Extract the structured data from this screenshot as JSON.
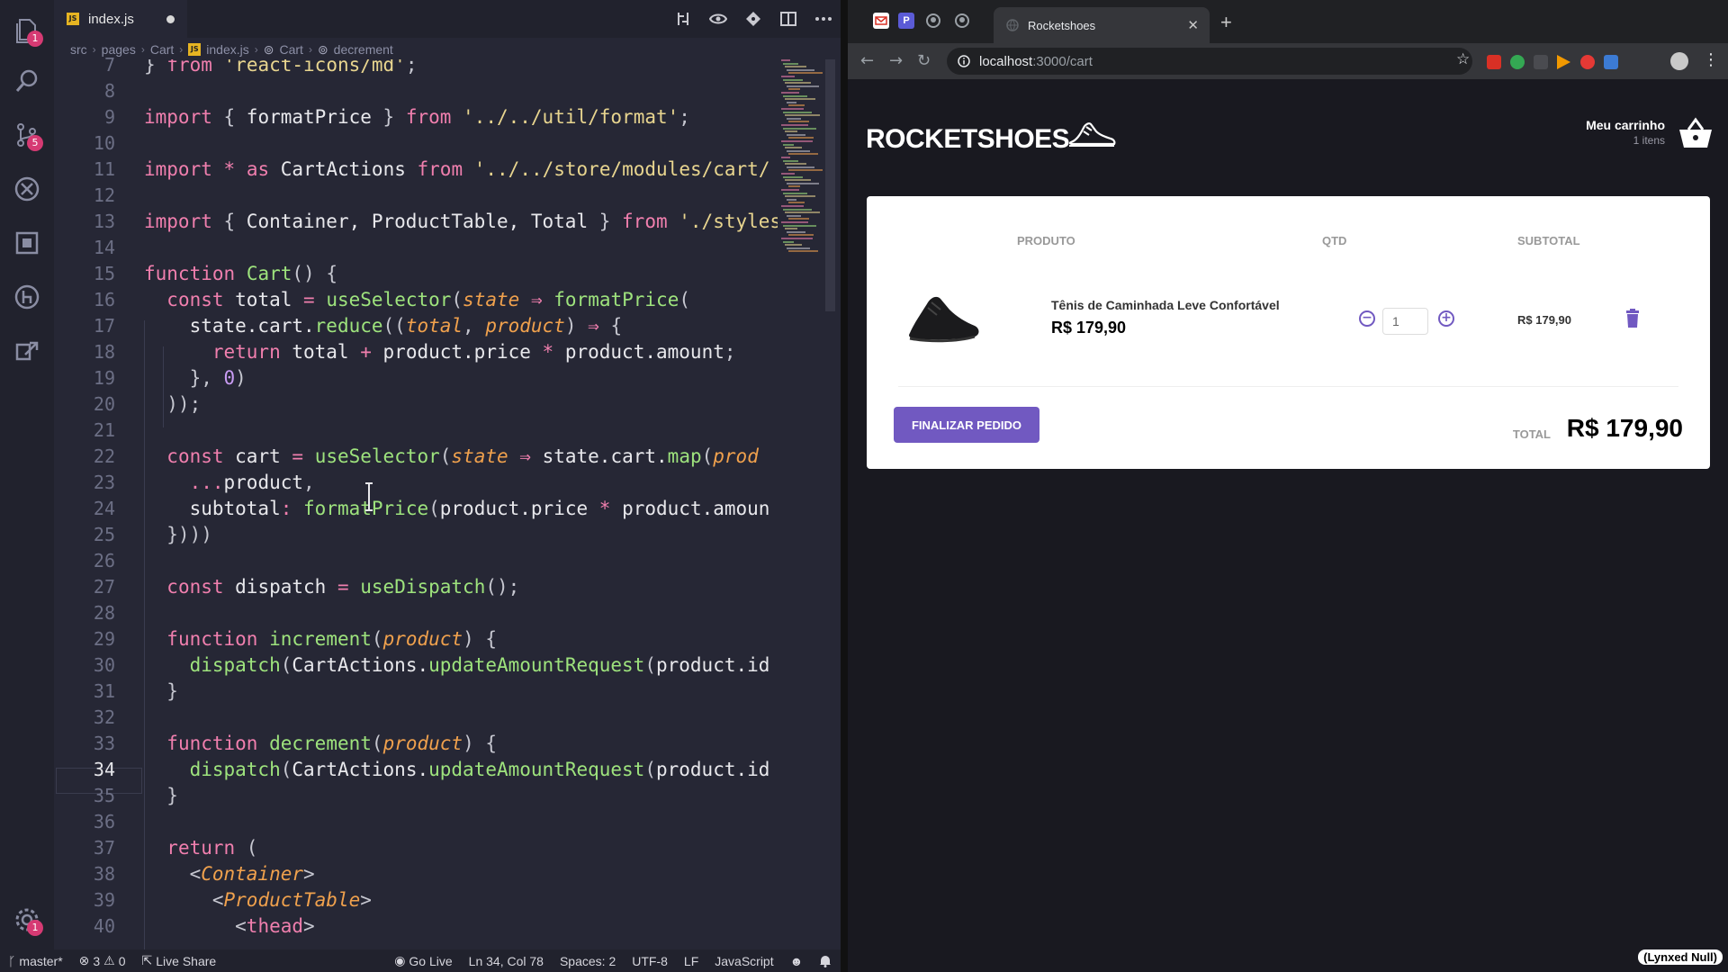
{
  "editor": {
    "tab": {
      "badge": "JS",
      "label": "index.js"
    },
    "breadcrumb": [
      "src",
      "pages",
      "Cart",
      "index.js",
      "Cart",
      "decrement"
    ],
    "activity_badges": {
      "explorer": "1",
      "scm": "5",
      "settings": "1"
    },
    "line_numbers": [
      "7",
      "8",
      "9",
      "10",
      "11",
      "12",
      "13",
      "14",
      "15",
      "16",
      "17",
      "18",
      "19",
      "20",
      "21",
      "22",
      "23",
      "24",
      "25",
      "26",
      "27",
      "28",
      "29",
      "30",
      "31",
      "32",
      "33",
      "34",
      "35",
      "36",
      "37",
      "38",
      "39",
      "40"
    ],
    "current_line": "34",
    "status": {
      "branch": "master*",
      "errors": "3",
      "warnings": "0",
      "live_share": "Live Share",
      "go_live": "Go Live",
      "position": "Ln 34, Col 78",
      "spaces": "Spaces: 2",
      "encoding": "UTF-8",
      "eol": "LF",
      "language": "JavaScript"
    }
  },
  "code_lines": [
    [
      [
        "pun",
        "} "
      ],
      [
        "kw",
        "from"
      ],
      [
        "pun",
        " "
      ],
      [
        "str",
        "'react-icons/md'"
      ],
      [
        "pun",
        ";"
      ]
    ],
    [],
    [
      [
        "kw",
        "import"
      ],
      [
        "pun",
        " { "
      ],
      [
        "var",
        "formatPrice"
      ],
      [
        "pun",
        " } "
      ],
      [
        "kw",
        "from"
      ],
      [
        "pun",
        " "
      ],
      [
        "str",
        "'../../util/format'"
      ],
      [
        "pun",
        ";"
      ]
    ],
    [],
    [
      [
        "kw",
        "import"
      ],
      [
        "pun",
        " "
      ],
      [
        "op",
        "*"
      ],
      [
        "pun",
        " "
      ],
      [
        "kw",
        "as"
      ],
      [
        "pun",
        " "
      ],
      [
        "var",
        "CartActions"
      ],
      [
        "pun",
        " "
      ],
      [
        "kw",
        "from"
      ],
      [
        "pun",
        " "
      ],
      [
        "str",
        "'../../store/modules/cart/"
      ]
    ],
    [],
    [
      [
        "kw",
        "import"
      ],
      [
        "pun",
        " { "
      ],
      [
        "var",
        "Container, ProductTable, Total"
      ],
      [
        "pun",
        " } "
      ],
      [
        "kw",
        "from"
      ],
      [
        "pun",
        " "
      ],
      [
        "str",
        "'./styles"
      ]
    ],
    [],
    [
      [
        "kw",
        "function"
      ],
      [
        "pun",
        " "
      ],
      [
        "fn",
        "Cart"
      ],
      [
        "pun",
        "() {"
      ]
    ],
    [
      [
        "pun",
        "  "
      ],
      [
        "kw",
        "const"
      ],
      [
        "var",
        " total "
      ],
      [
        "op",
        "="
      ],
      [
        "pun",
        " "
      ],
      [
        "fn",
        "useSelector"
      ],
      [
        "pun",
        "("
      ],
      [
        "par",
        "state"
      ],
      [
        "pun",
        " "
      ],
      [
        "op",
        "⇒"
      ],
      [
        "pun",
        " "
      ],
      [
        "fn",
        "formatPrice"
      ],
      [
        "pun",
        "("
      ]
    ],
    [
      [
        "var",
        "    state.cart."
      ],
      [
        "fn",
        "reduce"
      ],
      [
        "pun",
        "(("
      ],
      [
        "par",
        "total"
      ],
      [
        "pun",
        ", "
      ],
      [
        "par",
        "product"
      ],
      [
        "pun",
        ") "
      ],
      [
        "op",
        "⇒"
      ],
      [
        "pun",
        " {"
      ]
    ],
    [
      [
        "pun",
        "      "
      ],
      [
        "kw",
        "return"
      ],
      [
        "var",
        " total "
      ],
      [
        "op",
        "+"
      ],
      [
        "var",
        " product.price "
      ],
      [
        "op",
        "*"
      ],
      [
        "var",
        " product.amount"
      ],
      [
        "pun",
        ";"
      ]
    ],
    [
      [
        "pun",
        "    }, "
      ],
      [
        "num",
        "0"
      ],
      [
        "pun",
        ")"
      ]
    ],
    [
      [
        "pun",
        "  ));"
      ]
    ],
    [],
    [
      [
        "pun",
        "  "
      ],
      [
        "kw",
        "const"
      ],
      [
        "var",
        " cart "
      ],
      [
        "op",
        "="
      ],
      [
        "pun",
        " "
      ],
      [
        "fn",
        "useSelector"
      ],
      [
        "pun",
        "("
      ],
      [
        "par",
        "state"
      ],
      [
        "pun",
        " "
      ],
      [
        "op",
        "⇒"
      ],
      [
        "var",
        " state.cart."
      ],
      [
        "fn",
        "map"
      ],
      [
        "pun",
        "("
      ],
      [
        "par",
        "prod"
      ]
    ],
    [
      [
        "pun",
        "    "
      ],
      [
        "op",
        "..."
      ],
      [
        "var",
        "product"
      ],
      [
        "pun",
        ","
      ]
    ],
    [
      [
        "var",
        "    subtotal"
      ],
      [
        "op",
        ":"
      ],
      [
        "pun",
        " "
      ],
      [
        "fn",
        "formatPrice"
      ],
      [
        "pun",
        "("
      ],
      [
        "var",
        "product.price "
      ],
      [
        "op",
        "*"
      ],
      [
        "var",
        " product.amoun"
      ]
    ],
    [
      [
        "pun",
        "  }))"
      ],
      [
        "pun",
        ")"
      ]
    ],
    [],
    [
      [
        "pun",
        "  "
      ],
      [
        "kw",
        "const"
      ],
      [
        "var",
        " dispatch "
      ],
      [
        "op",
        "="
      ],
      [
        "pun",
        " "
      ],
      [
        "fn",
        "useDispatch"
      ],
      [
        "pun",
        "();"
      ]
    ],
    [],
    [
      [
        "pun",
        "  "
      ],
      [
        "kw",
        "function"
      ],
      [
        "pun",
        " "
      ],
      [
        "fn",
        "increment"
      ],
      [
        "pun",
        "("
      ],
      [
        "par",
        "product"
      ],
      [
        "pun",
        ") {"
      ]
    ],
    [
      [
        "pun",
        "    "
      ],
      [
        "fn",
        "dispatch"
      ],
      [
        "pun",
        "("
      ],
      [
        "var",
        "CartActions."
      ],
      [
        "fn",
        "updateAmountRequest"
      ],
      [
        "pun",
        "("
      ],
      [
        "var",
        "product.id"
      ]
    ],
    [
      [
        "pun",
        "  }"
      ]
    ],
    [],
    [
      [
        "pun",
        "  "
      ],
      [
        "kw",
        "function"
      ],
      [
        "pun",
        " "
      ],
      [
        "fn",
        "decrement"
      ],
      [
        "pun",
        "("
      ],
      [
        "par",
        "product"
      ],
      [
        "pun",
        ") {"
      ]
    ],
    [
      [
        "pun",
        "    "
      ],
      [
        "fn",
        "dispatch"
      ],
      [
        "pun",
        "("
      ],
      [
        "var",
        "CartActions."
      ],
      [
        "fn",
        "updateAmountRequest"
      ],
      [
        "pun",
        "("
      ],
      [
        "var",
        "product.id"
      ]
    ],
    [
      [
        "pun",
        "  }"
      ]
    ],
    [],
    [
      [
        "pun",
        "  "
      ],
      [
        "kw",
        "return"
      ],
      [
        "pun",
        " ("
      ]
    ],
    [
      [
        "pun",
        "    <"
      ],
      [
        "tag",
        "Container"
      ],
      [
        "pun",
        ">"
      ]
    ],
    [
      [
        "pun",
        "      <"
      ],
      [
        "tag",
        "ProductTable"
      ],
      [
        "pun",
        ">"
      ]
    ],
    [
      [
        "pun",
        "        <"
      ],
      [
        "kw",
        "thead"
      ],
      [
        "pun",
        ">"
      ]
    ]
  ],
  "colors": {
    "kw": "#f07fae",
    "str": "#e8d58f",
    "fn": "#9ee37d",
    "var": "#e8e8ec",
    "par": "#f0a14d",
    "op": "#f07fae",
    "num": "#c89bf3",
    "tag": "#f0a14d",
    "pun": "#c6c7d0",
    "accent": "#7159c1"
  },
  "browser": {
    "tab_title": "Rocketshoes",
    "url_host": "localhost",
    "url_rest": ":3000/cart",
    "new_tab": "+"
  },
  "store": {
    "logo": "ROCKETSHOES",
    "cart_title": "Meu carrinho",
    "cart_count": "1 itens",
    "headers": {
      "product": "PRODUTO",
      "qty": "QTD",
      "subtotal": "SUBTOTAL"
    },
    "item": {
      "name": "Tênis de Caminhada Leve Confortável",
      "price": "R$ 179,90",
      "qty": "1",
      "subtotal": "R$ 179,90"
    },
    "finish_button": "FINALIZAR PEDIDO",
    "total_label": "TOTAL",
    "total_value": "R$ 179,90"
  },
  "watermark": "(Lynxed Null)"
}
